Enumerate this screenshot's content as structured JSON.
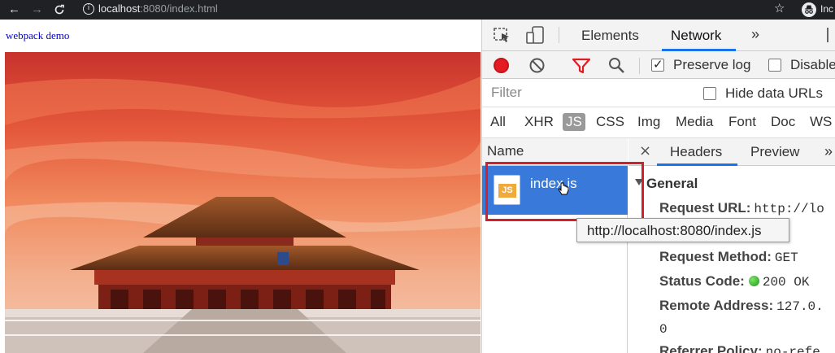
{
  "browser": {
    "url_host": "localhost",
    "url_port": ":8080",
    "url_path": "/index.html",
    "profile_label": "Inc",
    "icons": [
      "back-icon",
      "forward-icon",
      "reload-icon",
      "info-icon",
      "star-icon",
      "incognito-icon"
    ]
  },
  "page": {
    "title": "webpack demo"
  },
  "devtools": {
    "tabs": [
      {
        "label": "Elements",
        "active": false
      },
      {
        "label": "Network",
        "active": true
      }
    ],
    "more_tabs": "»",
    "toolbar": {
      "preserve_log_label": "Preserve log",
      "preserve_log_checked": true,
      "disable_cache_label": "Disable"
    },
    "filter": {
      "placeholder": "Filter",
      "hide_data_urls_label": "Hide data URLs",
      "hide_data_urls_checked": false
    },
    "types": [
      {
        "label": "All",
        "active": false
      },
      {
        "label": "XHR",
        "active": false
      },
      {
        "label": "JS",
        "active": true
      },
      {
        "label": "CSS",
        "active": false
      },
      {
        "label": "Img",
        "active": false
      },
      {
        "label": "Media",
        "active": false
      },
      {
        "label": "Font",
        "active": false
      },
      {
        "label": "Doc",
        "active": false
      },
      {
        "label": "WS",
        "active": false
      }
    ],
    "name_column_header": "Name",
    "requests": [
      {
        "name": "index.js",
        "icon_label": "JS",
        "selected": true
      }
    ],
    "detail_tabs": [
      {
        "label": "Headers",
        "active": true
      },
      {
        "label": "Preview",
        "active": false
      }
    ],
    "detail_more": "»",
    "close_symbol": "×",
    "general": {
      "section_title": "General",
      "request_url_key": "Request URL:",
      "request_url_value": "http://lo",
      "request_method_key": "Request Method:",
      "request_method_value": "GET",
      "status_code_key": "Status Code:",
      "status_code_value": "200 OK",
      "remote_address_key": "Remote Address:",
      "remote_address_value": "127.0.",
      "remote_address_wrap": "0",
      "referrer_policy_key": "Referrer Policy:",
      "referrer_policy_value": "no-refe"
    },
    "tooltip": "http://localhost:8080/index.js",
    "accent_color": "#1a73e8",
    "selected_row_color": "#3879d9",
    "highlight_box_color": "#d1202a"
  }
}
